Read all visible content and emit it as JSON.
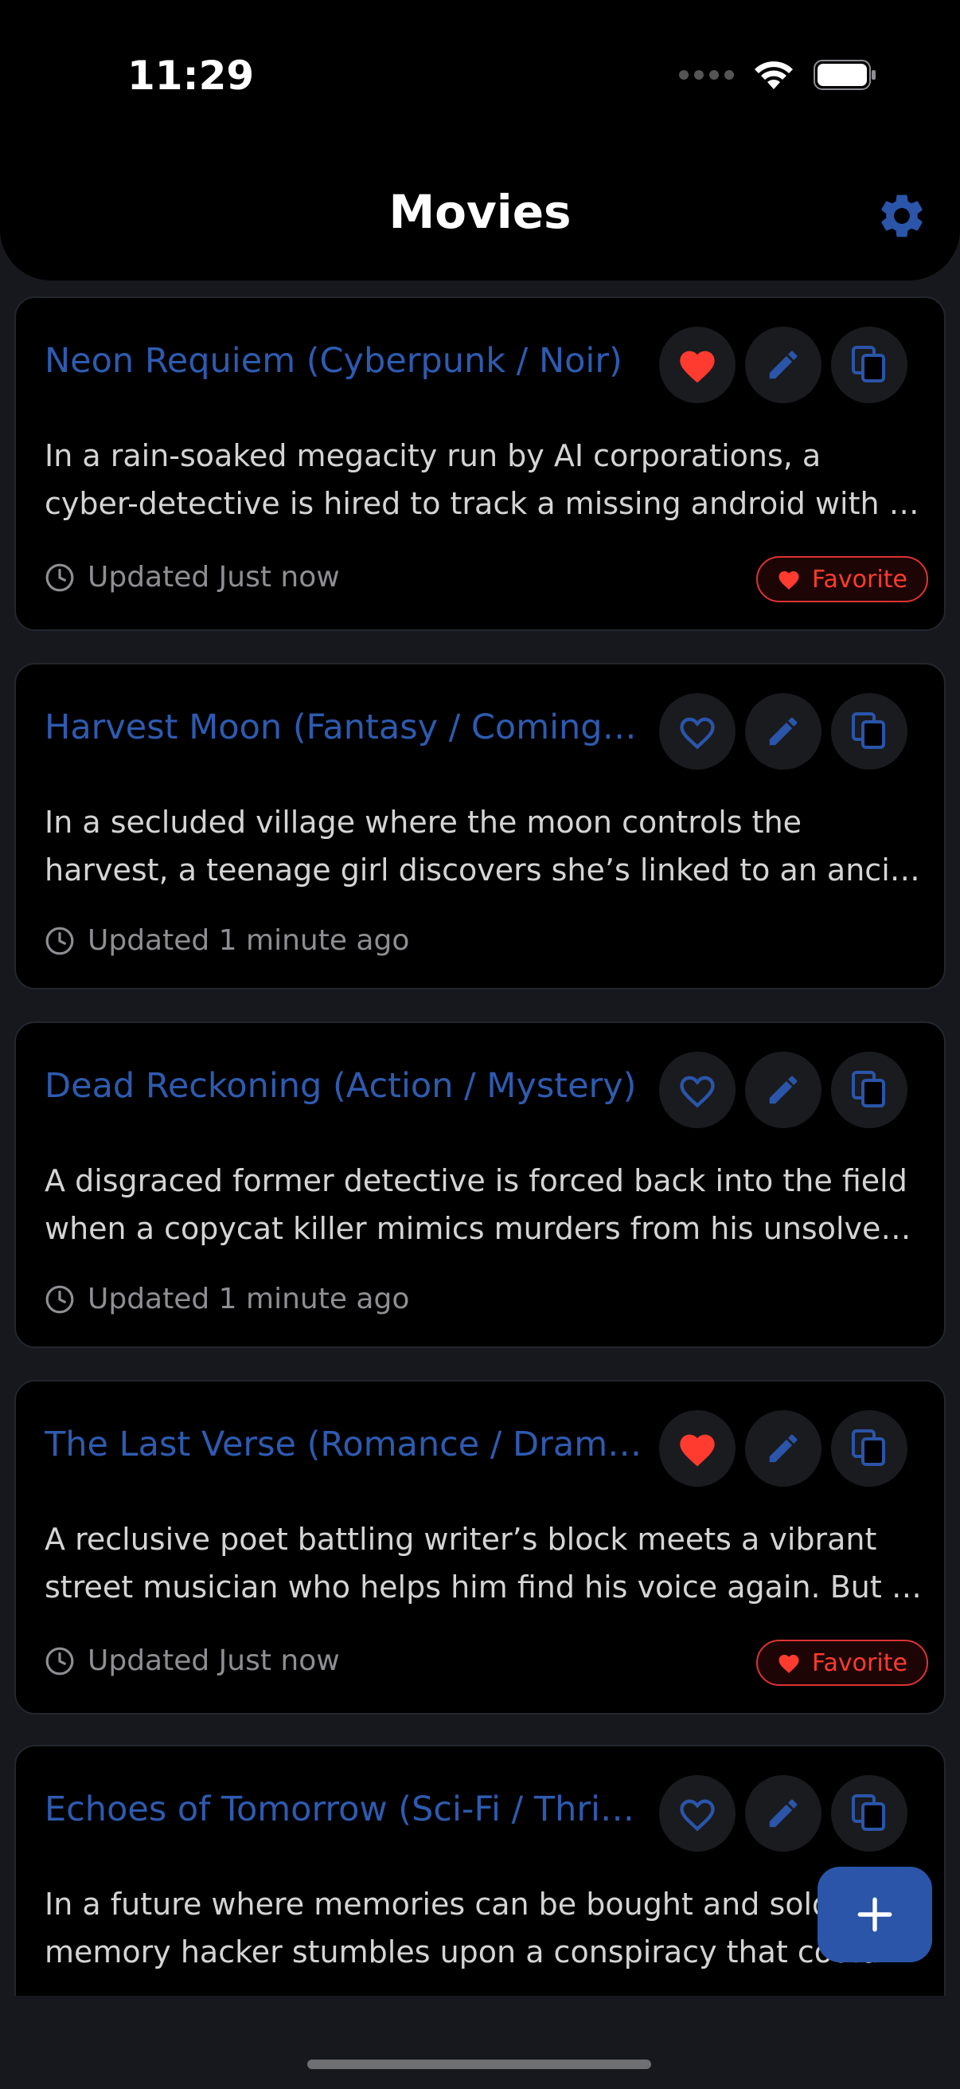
{
  "status": {
    "time": "11:29"
  },
  "header": {
    "title": "Movies"
  },
  "favorite_badge_label": "Favorite",
  "movies": [
    {
      "title": "Neon Requiem (Cyberpunk / Noir)",
      "desc_line1": "In a rain-soaked megacity run by AI corporations, a",
      "desc_line2": "cyber-detective is hired to track a missing android with …",
      "updated": "Updated Just now",
      "favorite": true
    },
    {
      "title": "Harvest Moon (Fantasy / Coming…",
      "desc_line1": "In a secluded village where the moon controls the",
      "desc_line2": "harvest, a teenage girl discovers she’s linked to an ancie…",
      "updated": "Updated 1 minute ago",
      "favorite": false
    },
    {
      "title": "Dead Reckoning (Action / Mystery)",
      "desc_line1": "A disgraced former detective is forced back into the field",
      "desc_line2": "when a copycat killer mimics murders from his unsolved …",
      "updated": "Updated 1 minute ago",
      "favorite": false
    },
    {
      "title": "The Last Verse (Romance / Dram…",
      "desc_line1": "A reclusive poet battling writer’s block meets a vibrant",
      "desc_line2": "street musician who helps him find his voice again. But a…",
      "updated": "Updated Just now",
      "favorite": true
    },
    {
      "title": "Echoes of Tomorrow (Sci-Fi / Thri…",
      "desc_line1": "In a future where memories can be bought and sold,",
      "desc_line2": "memory hacker stumbles upon a conspiracy that could…",
      "updated": "",
      "favorite": false
    }
  ],
  "colors": {
    "accent": "#2e5bb0",
    "favorite_red": "#ff3b30",
    "background": "#16181d",
    "card": "#000000"
  },
  "icons": {
    "settings": "gear-icon",
    "favorite_on": "heart-filled-icon",
    "favorite_off": "heart-outline-icon",
    "edit": "pencil-icon",
    "duplicate": "copy-icon",
    "updated": "clock-icon",
    "add": "plus-icon"
  }
}
